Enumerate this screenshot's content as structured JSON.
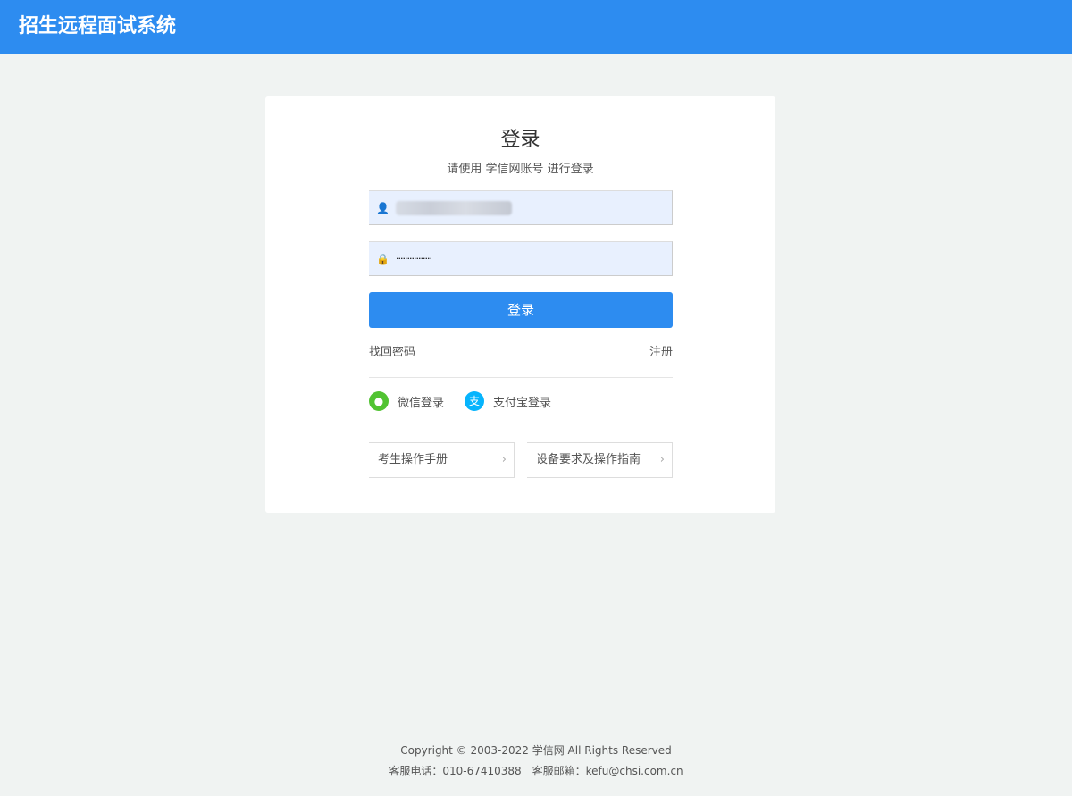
{
  "header": {
    "title": "招生远程面试系统"
  },
  "login": {
    "title": "登录",
    "subtitle": "请使用 学信网账号 进行登录",
    "password_mask": "················",
    "submit": "登录",
    "forgot": "找回密码",
    "register": "注册",
    "wechat": "微信登录",
    "alipay": "支付宝登录",
    "guide1": "考生操作手册",
    "guide2": "设备要求及操作指南"
  },
  "footer": {
    "copyright": "Copyright © 2003-2022 学信网 All Rights Reserved",
    "contact": "客服电话：010-67410388　客服邮箱：kefu@chsi.com.cn"
  },
  "colors": {
    "primary": "#2d8cf0",
    "wechat": "#51c332",
    "alipay": "#06b4fd"
  }
}
